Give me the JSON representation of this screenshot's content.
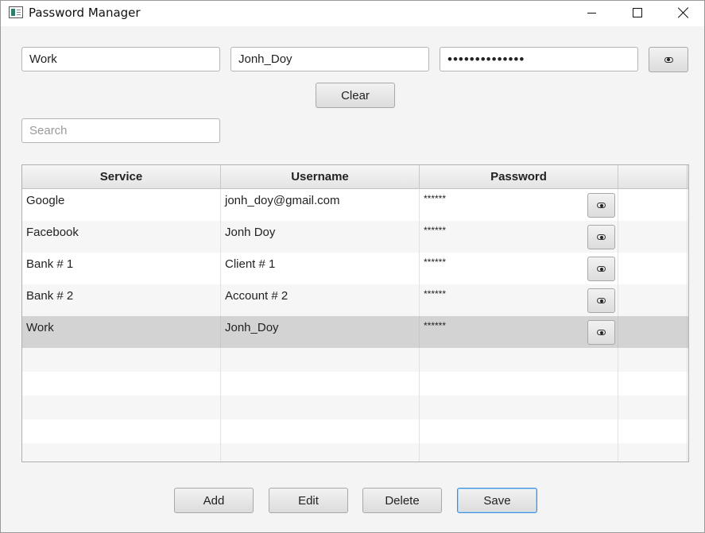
{
  "window": {
    "title": "Password Manager"
  },
  "form": {
    "service_value": "Work",
    "username_value": "Jonh_Doy",
    "password_value": "••••••••••••••",
    "search_placeholder": "Search",
    "clear_label": "Clear"
  },
  "table": {
    "columns": [
      "Service",
      "Username",
      "Password",
      ""
    ],
    "rows": [
      {
        "service": "Google",
        "username": "jonh_doy@gmail.com",
        "password": "******"
      },
      {
        "service": "Facebook",
        "username": "Jonh Doy",
        "password": "******"
      },
      {
        "service": "Bank # 1",
        "username": "Client # 1",
        "password": "******"
      },
      {
        "service": "Bank # 2",
        "username": "Account # 2",
        "password": "******"
      },
      {
        "service": "Work",
        "username": "Jonh_Doy",
        "password": "******",
        "selected": true
      }
    ]
  },
  "actions": {
    "add_label": "Add",
    "edit_label": "Edit",
    "delete_label": "Delete",
    "save_label": "Save"
  },
  "icons": {
    "show_password": "eye-icon",
    "app": "app-window-icon"
  },
  "colors": {
    "selected_row": "#d3d3d3",
    "focus_border": "#3c8fd8"
  }
}
